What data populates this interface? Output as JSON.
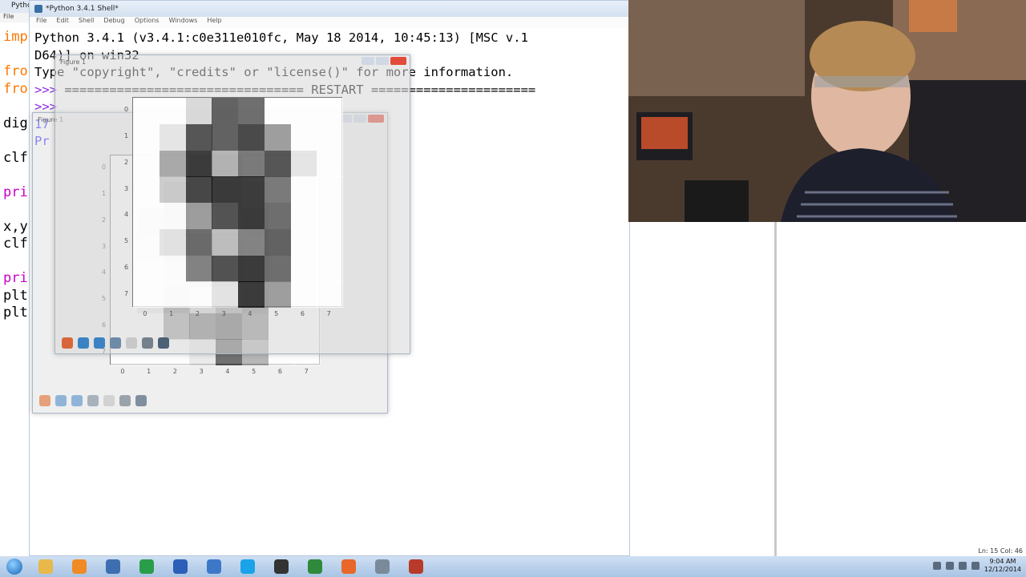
{
  "editor": {
    "title": "Pytho",
    "menu": "File",
    "lines": [
      "imp",
      "",
      "fro",
      "fro",
      "",
      "dig",
      "",
      "clf",
      "",
      "pri",
      "",
      "x,y",
      "clf",
      "",
      "pri",
      "plt",
      "plt"
    ]
  },
  "shell": {
    "title": "*Python 3.4.1 Shell*",
    "menu": [
      "File",
      "Edit",
      "Shell",
      "Debug",
      "Options",
      "Windows",
      "Help"
    ],
    "line1": "Python 3.4.1 (v3.4.1:c0e311e010fc, May 18 2014, 10:45:13) [MSC v.1",
    "line2": "D64)] on win32",
    "line3": "Type \"copyright\", \"credits\" or \"license()\" for more information.",
    "line4_prompt": ">>> ",
    "line4_rest": "================================ RESTART ======================",
    "line5_prompt": ">>> ",
    "line6": "17",
    "line7": "Pr"
  },
  "figure_front": {
    "title": "Figure 1",
    "xticks": [
      "0",
      "1",
      "2",
      "3",
      "4",
      "5",
      "6",
      "7"
    ],
    "yticks": [
      "0",
      "1",
      "2",
      "3",
      "4",
      "5",
      "6",
      "7"
    ]
  },
  "figure_back": {
    "title": "Figure 1",
    "xticks": [
      "0",
      "1",
      "2",
      "3",
      "4",
      "5",
      "6",
      "7"
    ],
    "yticks": [
      "0",
      "1",
      "2",
      "3",
      "4",
      "5",
      "6",
      "7"
    ]
  },
  "status": {
    "line_col": "Ln: 15 Col: 46"
  },
  "tray": {
    "time": "9:04 AM",
    "date": "12/12/2014"
  },
  "digit_image": [
    [
      0,
      0,
      3,
      13,
      12,
      0,
      0,
      0
    ],
    [
      0,
      2,
      14,
      13,
      15,
      8,
      0,
      0
    ],
    [
      0,
      7,
      16,
      6,
      11,
      14,
      2,
      0
    ],
    [
      0,
      4,
      15,
      16,
      16,
      11,
      0,
      0
    ],
    [
      0,
      0,
      8,
      14,
      16,
      12,
      0,
      0
    ],
    [
      0,
      2,
      12,
      5,
      10,
      13,
      0,
      0
    ],
    [
      0,
      0,
      10,
      14,
      16,
      12,
      0,
      0
    ],
    [
      0,
      0,
      0,
      2,
      16,
      8,
      0,
      0
    ]
  ],
  "taskbar": {
    "items": [
      "file-explorer-icon",
      "media-player-icon",
      "python-idle-icon",
      "chrome-icon",
      "editor-icon",
      "python-icon",
      "skype-icon",
      "app-icon",
      "terminal-icon",
      "firefox-icon",
      "camera-icon",
      "game-icon"
    ],
    "colors": [
      "#e8b84a",
      "#f08a24",
      "#3d6fb0",
      "#2a9d4a",
      "#2b5fb8",
      "#3d78c8",
      "#1aa3e8",
      "#333333",
      "#2f8a3c",
      "#e8672a",
      "#7a8a99",
      "#b83a2a"
    ]
  }
}
